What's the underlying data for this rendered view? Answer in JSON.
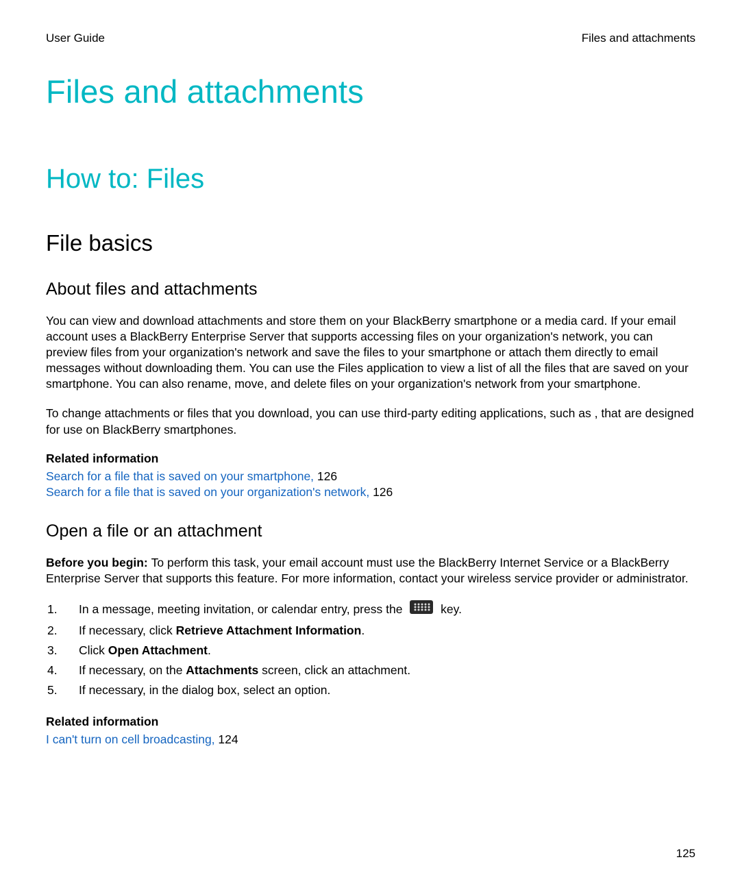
{
  "header": {
    "left": "User Guide",
    "right": "Files and attachments"
  },
  "h1": "Files and attachments",
  "h2": "How to: Files",
  "h3": "File basics",
  "section_about": {
    "title": "About files and attachments",
    "p1": "You can view and download attachments and store them on your BlackBerry smartphone or a media card. If your email account uses a BlackBerry Enterprise Server that supports accessing files on your organization's network, you can preview files from your organization's network and save the files to your smartphone or attach them directly to email messages without downloading them. You can use the Files application to view a list of all the files that are saved on your smartphone. You can also rename, move, and delete files on your organization's network from your smartphone.",
    "p2": "To change attachments or files that you download, you can use third-party editing applications, such as , that are designed for use on BlackBerry smartphones.",
    "related_title": "Related information",
    "links": [
      {
        "text": "Search for a file that is saved on your smartphone, ",
        "page": "126"
      },
      {
        "text": "Search for a file that is saved on your organization's network, ",
        "page": "126"
      }
    ]
  },
  "section_open": {
    "title": "Open a file or an attachment",
    "before_label": "Before you begin: ",
    "before_text": "To perform this task, your email account must use the BlackBerry Internet Service or a BlackBerry Enterprise Server that supports this feature. For more information, contact your wireless service provider or administrator.",
    "steps": [
      {
        "num": "1.",
        "pre": "In a message, meeting invitation, or calendar entry, press the ",
        "icon": "menu-key-icon",
        "post": " key."
      },
      {
        "num": "2.",
        "pre": "If necessary, click ",
        "bold": "Retrieve Attachment Information",
        "post": "."
      },
      {
        "num": "3.",
        "pre": "Click ",
        "bold": "Open Attachment",
        "post": "."
      },
      {
        "num": "4.",
        "pre": "If necessary, on the ",
        "bold": "Attachments",
        "post": " screen, click an attachment."
      },
      {
        "num": "5.",
        "pre": "If necessary, in the dialog box, select an option."
      }
    ],
    "related_title": "Related information",
    "links": [
      {
        "text": "I can't turn on cell broadcasting, ",
        "page": "124"
      }
    ]
  },
  "page_number": "125"
}
